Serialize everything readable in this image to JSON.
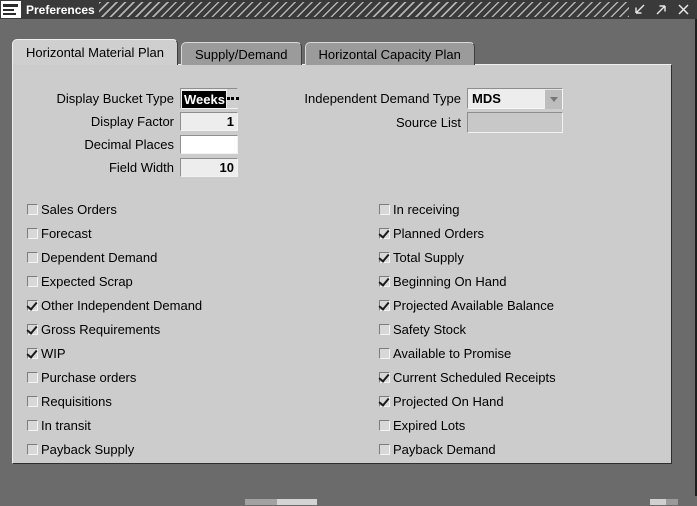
{
  "window": {
    "title": "Preferences",
    "icon": "oracle-forms-icon",
    "buttons": [
      {
        "name": "minimize-button",
        "glyph": "arrow-down-left"
      },
      {
        "name": "maximize-button",
        "glyph": "arrow-up-right"
      },
      {
        "name": "close-button",
        "glyph": "x"
      }
    ]
  },
  "tabs": [
    {
      "label": "Horizontal Material Plan",
      "active": true
    },
    {
      "label": "Supply/Demand",
      "active": false
    },
    {
      "label": "Horizontal Capacity Plan",
      "active": false
    }
  ],
  "form": {
    "left": [
      {
        "label": "Display Bucket Type",
        "value": "Weeks",
        "type": "lov",
        "selected": true
      },
      {
        "label": "Display Factor",
        "value": "1",
        "type": "text",
        "state": "normal"
      },
      {
        "label": "Decimal Places",
        "value": "",
        "type": "text",
        "state": "focused"
      },
      {
        "label": "Field Width",
        "value": "10",
        "type": "text",
        "state": "normal"
      }
    ],
    "right": [
      {
        "label": "Independent Demand Type",
        "value": "MDS",
        "type": "combo",
        "state": "normal"
      },
      {
        "label": "Source List",
        "value": "",
        "type": "text",
        "state": "disabled"
      }
    ]
  },
  "checkboxes": {
    "left": [
      {
        "label": "Sales Orders",
        "checked": false
      },
      {
        "label": "Forecast",
        "checked": false
      },
      {
        "label": "Dependent Demand",
        "checked": false
      },
      {
        "label": "Expected Scrap",
        "checked": false
      },
      {
        "label": "Other Independent Demand",
        "checked": true
      },
      {
        "label": "Gross Requirements",
        "checked": true
      },
      {
        "label": "WIP",
        "checked": true
      },
      {
        "label": "Purchase orders",
        "checked": false
      },
      {
        "label": "Requisitions",
        "checked": false
      },
      {
        "label": "In transit",
        "checked": false
      },
      {
        "label": "Payback Supply",
        "checked": false
      }
    ],
    "right": [
      {
        "label": "In receiving",
        "checked": false
      },
      {
        "label": "Planned Orders",
        "checked": true
      },
      {
        "label": "Total Supply",
        "checked": true
      },
      {
        "label": "Beginning On Hand",
        "checked": true
      },
      {
        "label": "Projected Available Balance",
        "checked": true
      },
      {
        "label": "Safety Stock",
        "checked": false
      },
      {
        "label": "Available to Promise",
        "checked": false
      },
      {
        "label": "Current Scheduled Receipts",
        "checked": true
      },
      {
        "label": "Projected On Hand",
        "checked": true
      },
      {
        "label": "Expired Lots",
        "checked": false
      },
      {
        "label": "Payback Demand",
        "checked": false
      }
    ]
  },
  "colors": {
    "titlebar": "#3a3a3a",
    "desktop": "#6b6b6b",
    "panel": "#cccccc",
    "tab_active": "#cfcfcf",
    "tab_inactive": "#9b9b9b",
    "field": "#ededed",
    "field_disabled": "#c8c8c8"
  }
}
